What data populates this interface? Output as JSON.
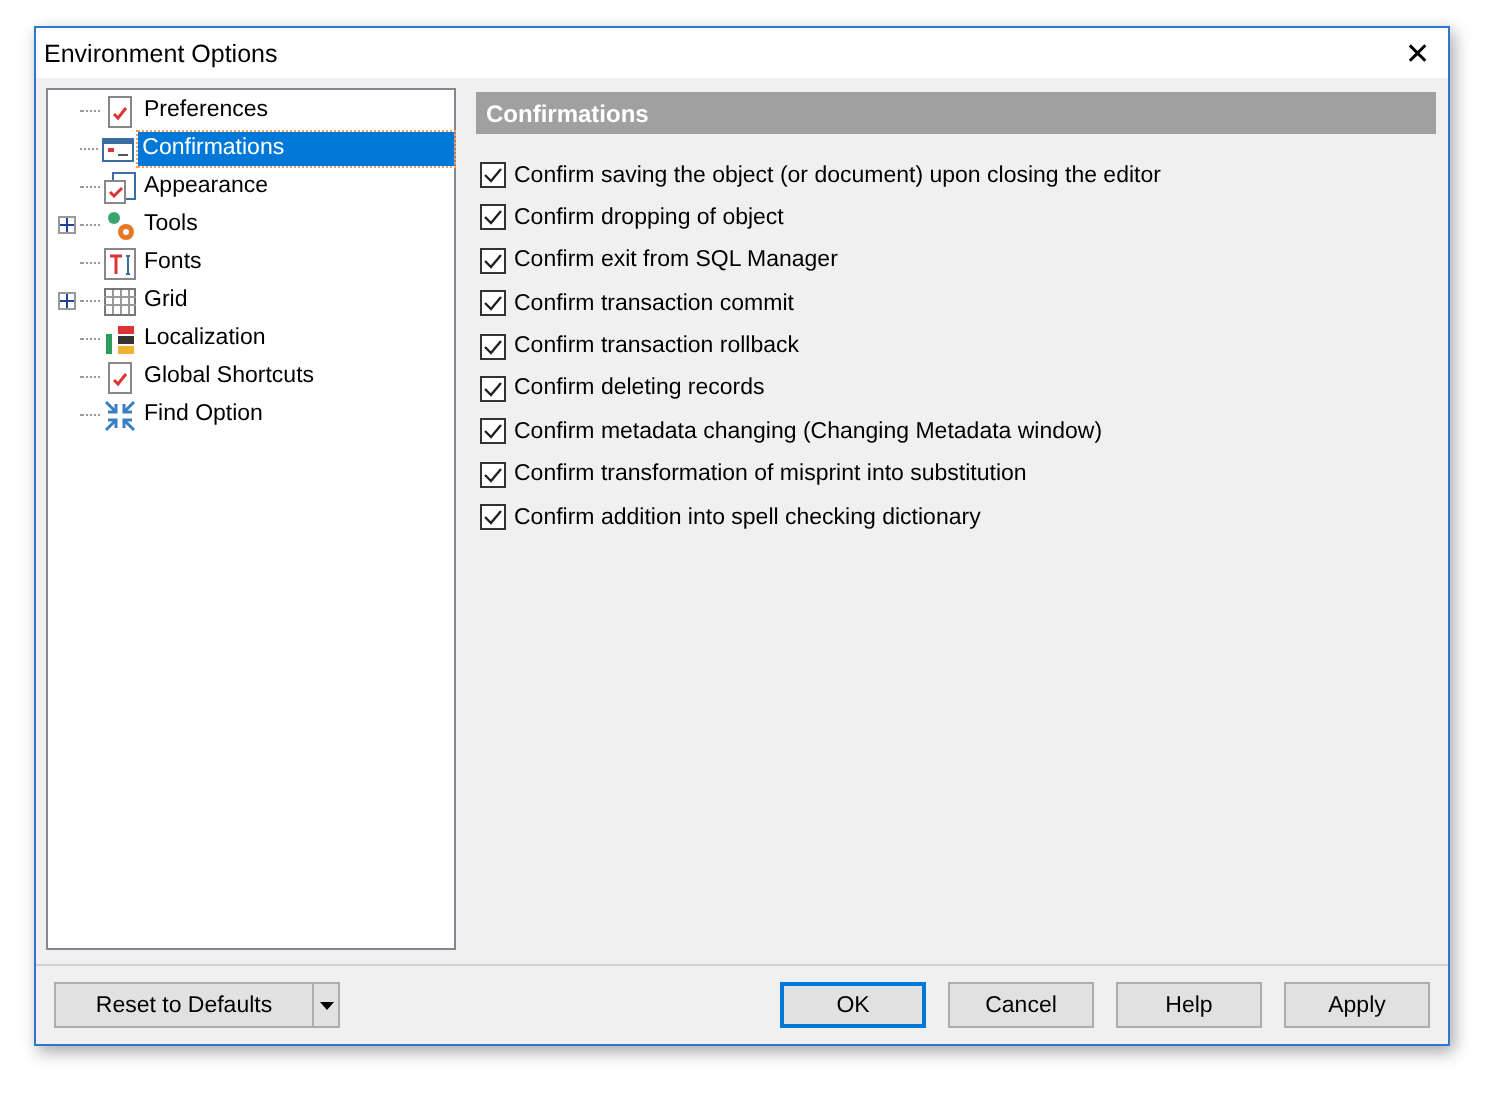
{
  "window": {
    "title": "Environment Options",
    "close": "✕"
  },
  "tree": {
    "items": [
      {
        "label": "Preferences",
        "selected": false
      },
      {
        "label": "Confirmations",
        "selected": true
      },
      {
        "label": "Appearance",
        "selected": false
      },
      {
        "label": "Tools",
        "selected": false,
        "expanded": false
      },
      {
        "label": "Fonts",
        "selected": false
      },
      {
        "label": "Grid",
        "selected": false,
        "expanded": false
      },
      {
        "label": "Localization",
        "selected": false
      },
      {
        "label": "Global Shortcuts",
        "selected": false
      },
      {
        "label": "Find Option",
        "selected": false
      }
    ]
  },
  "panel": {
    "title": "Confirmations",
    "options": [
      {
        "label": "Confirm saving the object (or document) upon closing the editor",
        "checked": true
      },
      {
        "label": "Confirm dropping of object",
        "checked": true
      },
      {
        "label": "Confirm exit from SQL Manager",
        "checked": true
      },
      {
        "label": "Confirm transaction commit",
        "checked": true
      },
      {
        "label": "Confirm transaction rollback",
        "checked": true
      },
      {
        "label": "Confirm deleting records",
        "checked": true
      },
      {
        "label": "Confirm metadata changing (Changing Metadata window)",
        "checked": true
      },
      {
        "label": "Confirm transformation of misprint into substitution",
        "checked": true
      },
      {
        "label": "Confirm addition into spell checking dictionary",
        "checked": true
      }
    ]
  },
  "buttons": {
    "reset": "Reset to Defaults",
    "ok": "OK",
    "cancel": "Cancel",
    "help": "Help",
    "apply": "Apply"
  }
}
